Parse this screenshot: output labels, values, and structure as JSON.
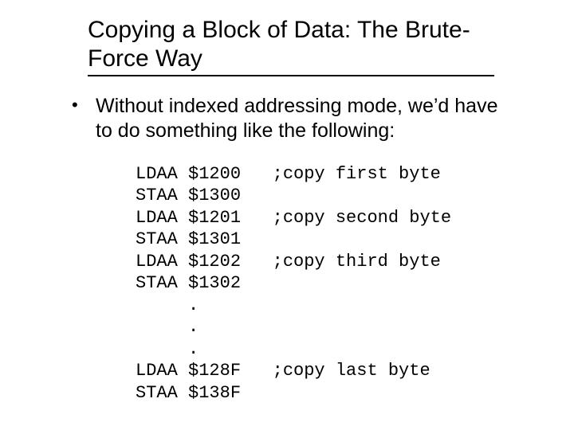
{
  "title": "Copying a Block of Data: The Brute-Force Way",
  "bullet": "Without indexed addressing mode, we’d have to do something like the following:",
  "code": {
    "l1": "LDAA $1200   ;copy first byte",
    "l2": "STAA $1300",
    "l3": "LDAA $1201   ;copy second byte",
    "l4": "STAA $1301",
    "l5": "LDAA $1202   ;copy third byte",
    "l6": "STAA $1302",
    "l7": "     .",
    "l8": "     .",
    "l9": "     .",
    "l10": "LDAA $128F   ;copy last byte",
    "l11": "STAA $138F"
  }
}
